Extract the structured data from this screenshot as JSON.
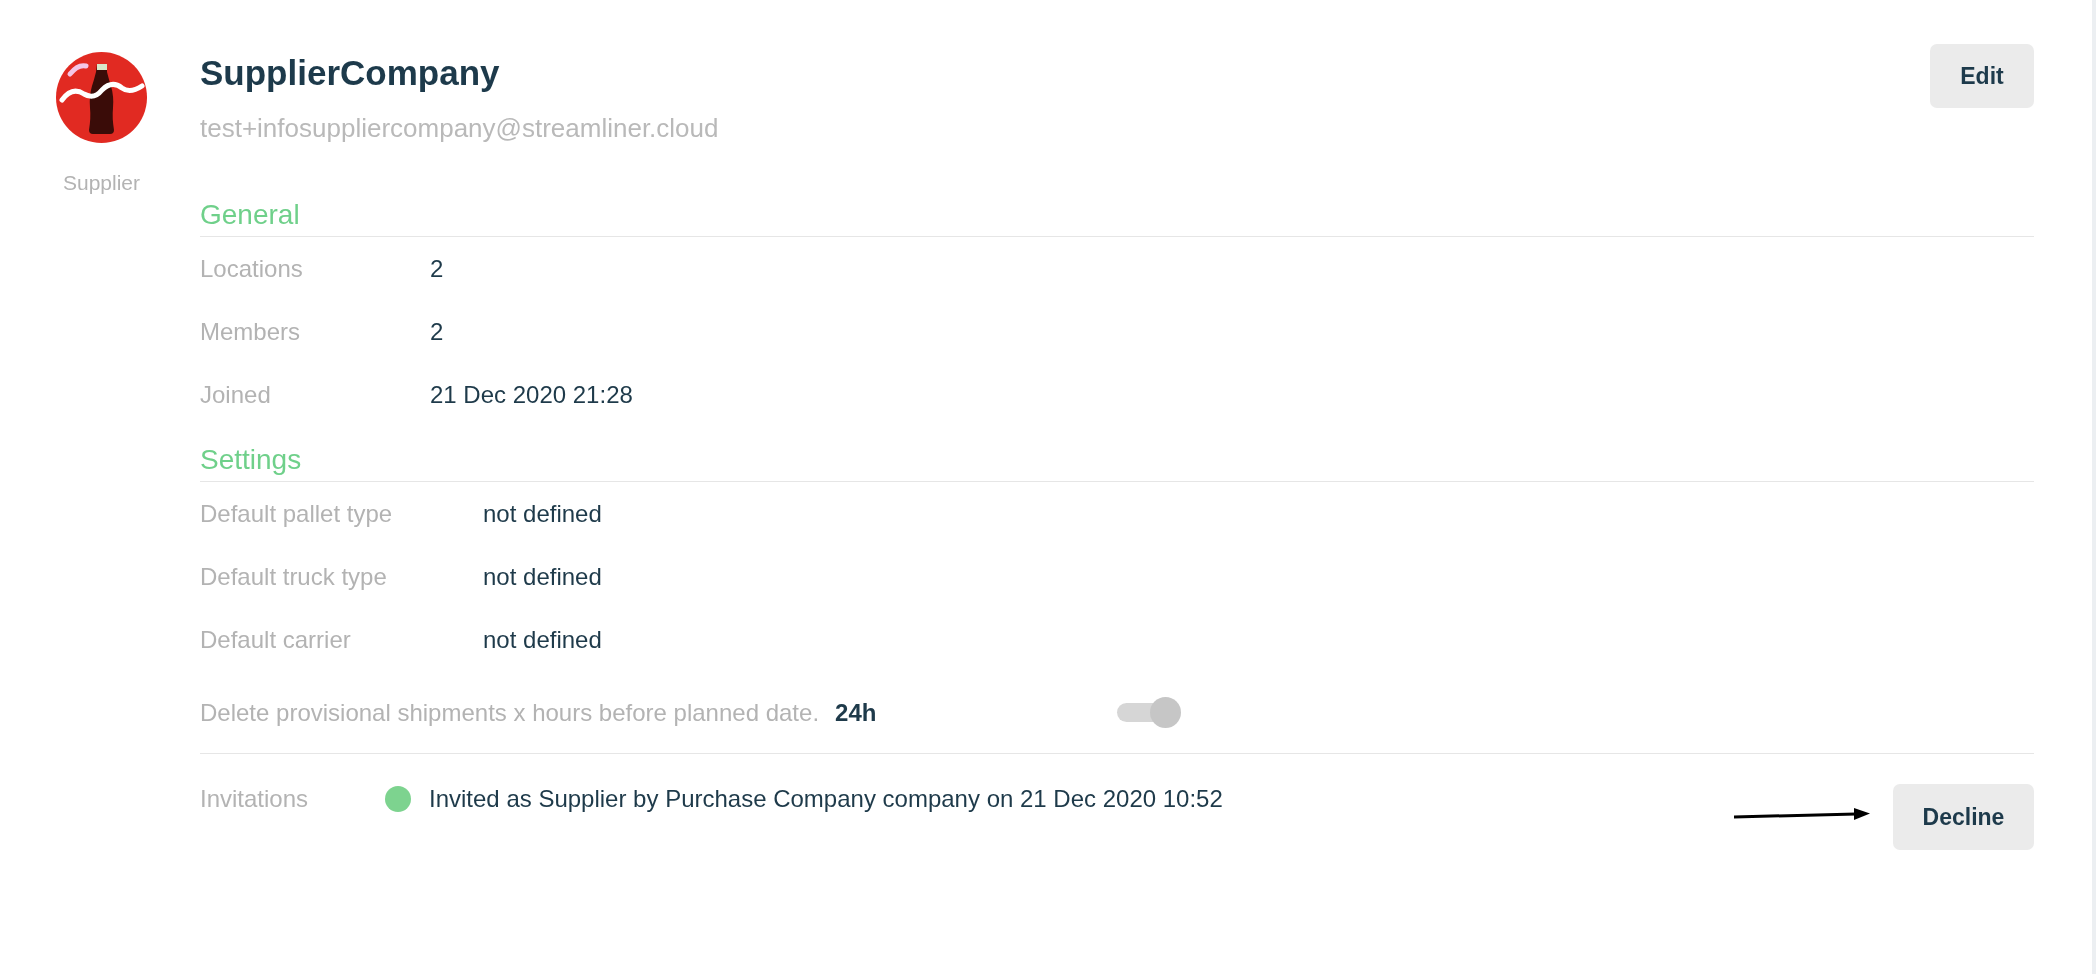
{
  "profile": {
    "caption": "Supplier",
    "name": "SupplierCompany",
    "email": "test+infosuppliercompany@streamliner.cloud"
  },
  "edit_button": "Edit",
  "sections": [
    {
      "title": "General",
      "rows": [
        {
          "kind": "text",
          "label": "Locations",
          "value": "2"
        },
        {
          "kind": "text",
          "label": "Members",
          "value": "2"
        },
        {
          "kind": "text",
          "label": "Joined",
          "value": "21 Dec 2020 21:28"
        }
      ]
    },
    {
      "title": "Settings",
      "rows": [
        {
          "kind": "text",
          "label": "Default pallet type",
          "value": "not defined"
        },
        {
          "kind": "text",
          "label": "Default truck type",
          "value": "not defined"
        },
        {
          "kind": "text",
          "label": "Default carrier",
          "value": "not defined"
        },
        {
          "kind": "toggle",
          "label": "Delete provisional shipments x hours before planned date.",
          "value": "24h",
          "on": true,
          "disabled": true
        }
      ]
    }
  ],
  "invitations": {
    "label": "Invitations",
    "items": [
      {
        "color": "#7dd38f",
        "text": "Invited as Supplier by Purchase Company company on 21 Dec 2020 10:52",
        "action": "Decline"
      }
    ]
  }
}
